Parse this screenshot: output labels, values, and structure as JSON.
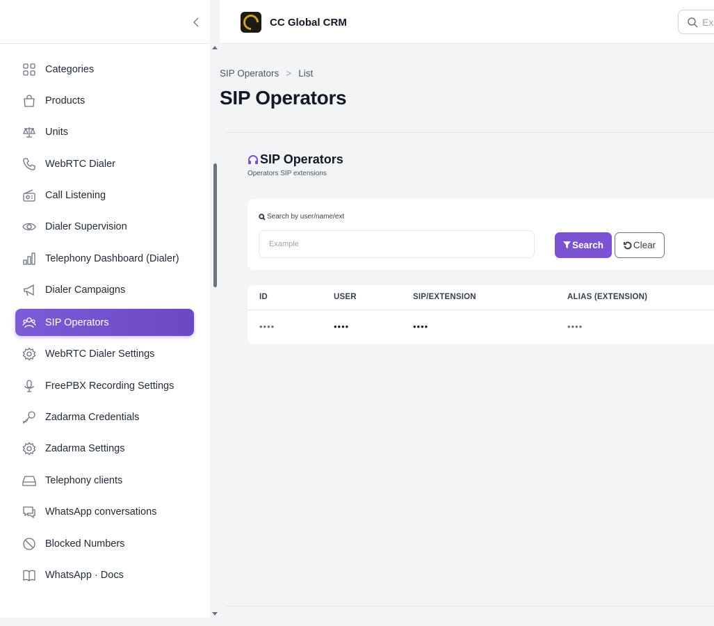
{
  "app": {
    "name": "CC Global CRM"
  },
  "header": {
    "search_placeholder": "Ex"
  },
  "sidebar": {
    "items": [
      {
        "label": "Categories",
        "icon": "grid-icon",
        "active": false
      },
      {
        "label": "Products",
        "icon": "shopping-bag-icon",
        "active": false
      },
      {
        "label": "Units",
        "icon": "scale-icon",
        "active": false
      },
      {
        "label": "WebRTC Dialer",
        "icon": "phone-icon",
        "active": false
      },
      {
        "label": "Call Listening",
        "icon": "radio-icon",
        "active": false
      },
      {
        "label": "Dialer Supervision",
        "icon": "eye-icon",
        "active": false
      },
      {
        "label": "Telephony Dashboard (Dialer)",
        "icon": "bar-chart-icon",
        "active": false
      },
      {
        "label": "Dialer Campaigns",
        "icon": "megaphone-icon",
        "active": false
      },
      {
        "label": "SIP Operators",
        "icon": "users-icon",
        "active": true
      },
      {
        "label": "WebRTC Dialer Settings",
        "icon": "cog-icon",
        "active": false
      },
      {
        "label": "FreePBX Recording Settings",
        "icon": "microphone-icon",
        "active": false
      },
      {
        "label": "Zadarma Credentials",
        "icon": "key-icon",
        "active": false
      },
      {
        "label": "Zadarma Settings",
        "icon": "cog-icon",
        "active": false
      },
      {
        "label": "Telephony clients",
        "icon": "inbox-icon",
        "active": false
      },
      {
        "label": "WhatsApp conversations",
        "icon": "chat-icon",
        "active": false
      },
      {
        "label": "Blocked Numbers",
        "icon": "ban-icon",
        "active": false
      },
      {
        "label": "WhatsApp · Docs",
        "icon": "book-icon",
        "active": false
      }
    ]
  },
  "breadcrumb": {
    "parent": "SIP Operators",
    "separator": ">",
    "current": "List"
  },
  "page": {
    "title": "SIP Operators"
  },
  "section": {
    "title": "SIP Operators",
    "subtitle": "Operators SIP extensions"
  },
  "filter": {
    "label": "Search by user/name/ext",
    "placeholder": "Example",
    "value": "",
    "search_label": "Search",
    "clear_label": "Clear"
  },
  "table": {
    "columns": [
      "ID",
      "USER",
      "SIP/EXTENSION",
      "ALIAS (EXTENSION)"
    ],
    "rows": [
      [
        "••••",
        "••••",
        "••••",
        "••••"
      ]
    ]
  },
  "colors": {
    "accent": "#7b52d1",
    "active_nav": "#6d47c4",
    "background": "#f3f4f6"
  }
}
